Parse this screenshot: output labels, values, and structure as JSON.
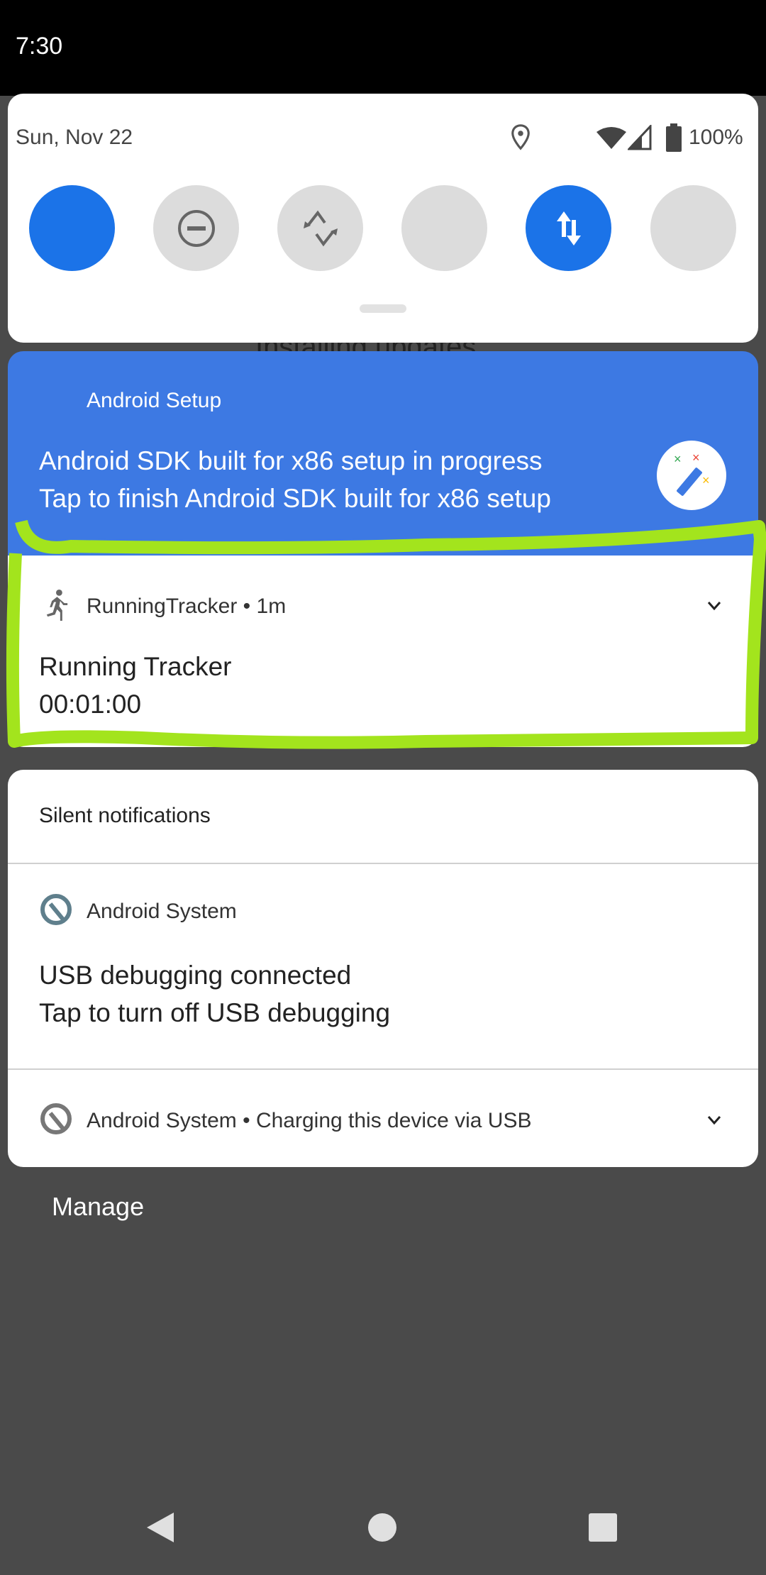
{
  "status_bar": {
    "time": "7:30"
  },
  "quick_settings": {
    "date": "Sun, Nov 22",
    "battery": "100%",
    "tiles": [
      {
        "icon": "wifi-icon",
        "active": true
      },
      {
        "icon": "do-not-disturb-icon",
        "active": false
      },
      {
        "icon": "auto-rotate-icon",
        "active": false
      },
      {
        "icon": "bluetooth-icon",
        "active": false
      },
      {
        "icon": "mobile-data-icon",
        "active": true
      },
      {
        "icon": "flashlight-icon",
        "active": false
      }
    ],
    "accent": "#1b73e8"
  },
  "behind_text": "Installing updates",
  "notifications": {
    "setup": {
      "app": "Android Setup",
      "title": "Android SDK built for x86 setup in progress",
      "text": "Tap to finish Android SDK built for x86 setup",
      "color": "#3d79e3"
    },
    "running": {
      "app": "RunningTracker",
      "time": "1m",
      "title": "Running Tracker",
      "text": "00:01:00",
      "highlight_color": "#a3e41d"
    },
    "silent": {
      "header": "Silent notifications",
      "usb": {
        "app": "Android System",
        "title": "USB debugging connected",
        "text": "Tap to turn off USB debugging"
      },
      "charging": {
        "app": "Android System",
        "title": "Charging this device via USB"
      }
    }
  },
  "manage_label": "Manage",
  "nav": [
    "back",
    "home",
    "recents"
  ]
}
